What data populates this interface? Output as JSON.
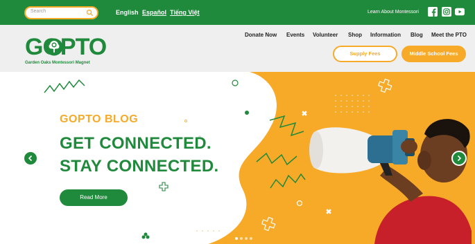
{
  "topbar": {
    "search_placeholder": "Search",
    "languages": [
      "English",
      "Español",
      "Tiếng Việt"
    ],
    "learn_link": "Learn About Montessori",
    "social_icons": [
      "facebook-icon",
      "instagram-icon",
      "youtube-icon"
    ]
  },
  "header": {
    "logo_text": "GOPTO",
    "logo_subtitle": "Garden Oaks Montessori Magnet",
    "nav": [
      "Donate Now",
      "Events",
      "Volunteer",
      "Shop",
      "Information",
      "Blog",
      "Meet the PTO"
    ],
    "buttons": {
      "supply_fees": "Supply Fees",
      "middle_school_fees": "Middle School Fees"
    }
  },
  "hero": {
    "label": "GOPTO BLOG",
    "headline_line1": "GET CONNECTED.",
    "headline_line2": "STAY CONNECTED.",
    "cta": "Read More",
    "slides": 4,
    "active_slide": 1
  },
  "colors": {
    "green": "#1f8a3b",
    "orange": "#f7a928",
    "gray": "#efefef"
  }
}
